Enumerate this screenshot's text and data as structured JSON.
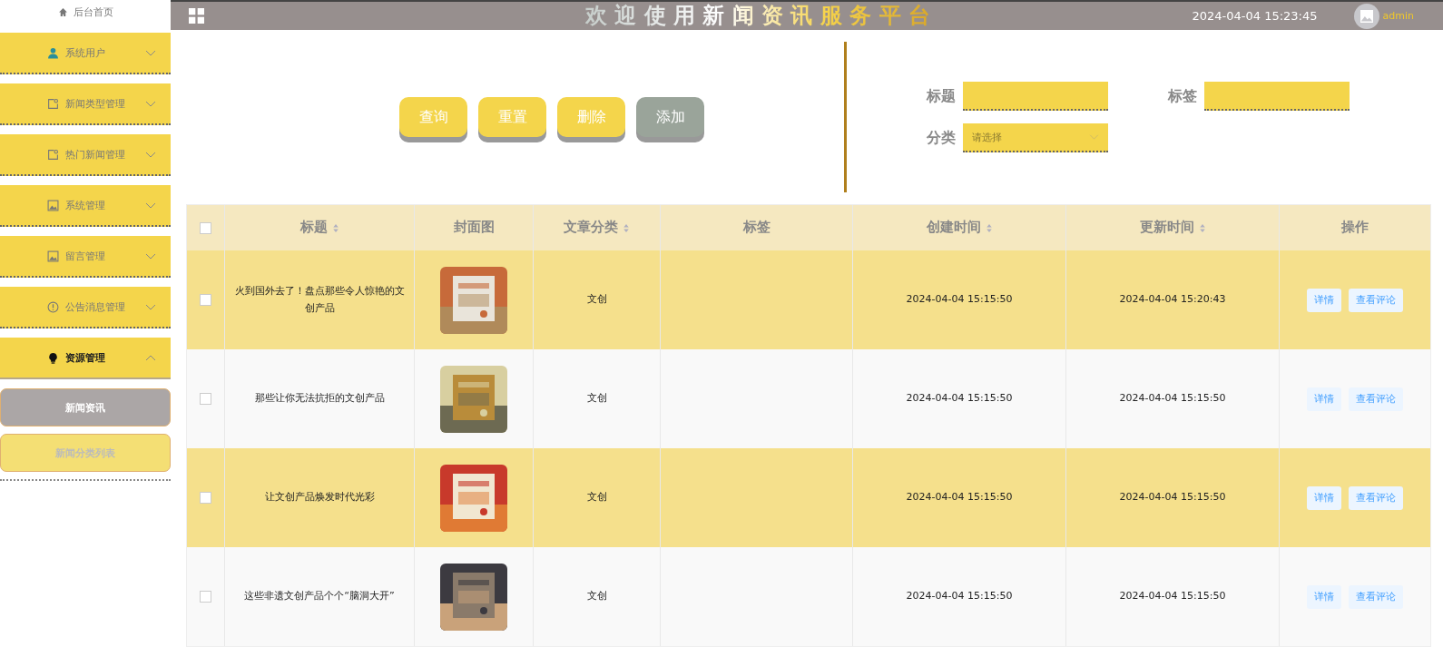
{
  "sidebar": {
    "home": "后台首页",
    "items": [
      {
        "label": "系统用户",
        "expanded": false
      },
      {
        "label": "新闻类型管理",
        "expanded": false
      },
      {
        "label": "热门新闻管理",
        "expanded": false
      },
      {
        "label": "系统管理",
        "expanded": false
      },
      {
        "label": "留言管理",
        "expanded": false
      },
      {
        "label": "公告消息管理",
        "expanded": false
      },
      {
        "label": "资源管理",
        "expanded": true,
        "children": [
          {
            "label": "新闻资讯",
            "selected": true
          },
          {
            "label": "新闻分类列表",
            "selected": false
          }
        ]
      }
    ]
  },
  "header": {
    "title": "欢 迎 使 用 新 闻 资 讯 服 务 平 台",
    "datetime": "2024-04-04 15:23:45",
    "user": "admin"
  },
  "actions": [
    {
      "label": "查询",
      "highlighted": false
    },
    {
      "label": "重置",
      "highlighted": false
    },
    {
      "label": "删除",
      "highlighted": false
    },
    {
      "label": "添加",
      "highlighted": true
    }
  ],
  "search": {
    "fields": [
      {
        "label": "标题",
        "kind": "input"
      },
      {
        "label": "标签",
        "kind": "input"
      },
      {
        "label": "分类",
        "kind": "select",
        "placeholder": "请选择"
      }
    ]
  },
  "table": {
    "all_checked": false,
    "columns": [
      {
        "label": "标题",
        "sortable": true
      },
      {
        "label": "封面图",
        "sortable": false
      },
      {
        "label": "文章分类",
        "sortable": true
      },
      {
        "label": "标签",
        "sortable": false
      },
      {
        "label": "创建时间",
        "sortable": true
      },
      {
        "label": "更新时间",
        "sortable": true
      },
      {
        "label": "操作",
        "sortable": false
      }
    ],
    "rows": [
      {
        "title": "火到国外去了！盘点那些令人惊艳的文创产品",
        "category": "文创",
        "created": "2024-04-04 15:15:50",
        "updated": "2024-04-04 15:20:43",
        "actions": [
          "详情",
          "查看评论"
        ],
        "checked": false
      },
      {
        "title": "那些让你无法抗拒的文创产品",
        "category": "文创",
        "created": "2024-04-04 15:15:50",
        "updated": "2024-04-04 15:15:50",
        "actions": [
          "详情",
          "查看评论"
        ],
        "checked": false
      },
      {
        "title": "让文创产品焕发时代光彩",
        "category": "文创",
        "created": "2024-04-04 15:15:50",
        "updated": "2024-04-04 15:15:50",
        "actions": [
          "详情",
          "查看评论"
        ],
        "checked": false
      },
      {
        "title": "这些非遗文创产品个个“脑洞大开”",
        "category": "文创",
        "created": "2024-04-04 15:15:50",
        "updated": "2024-04-04 15:15:50",
        "actions": [
          "详情",
          "查看评论"
        ],
        "checked": false
      }
    ]
  }
}
